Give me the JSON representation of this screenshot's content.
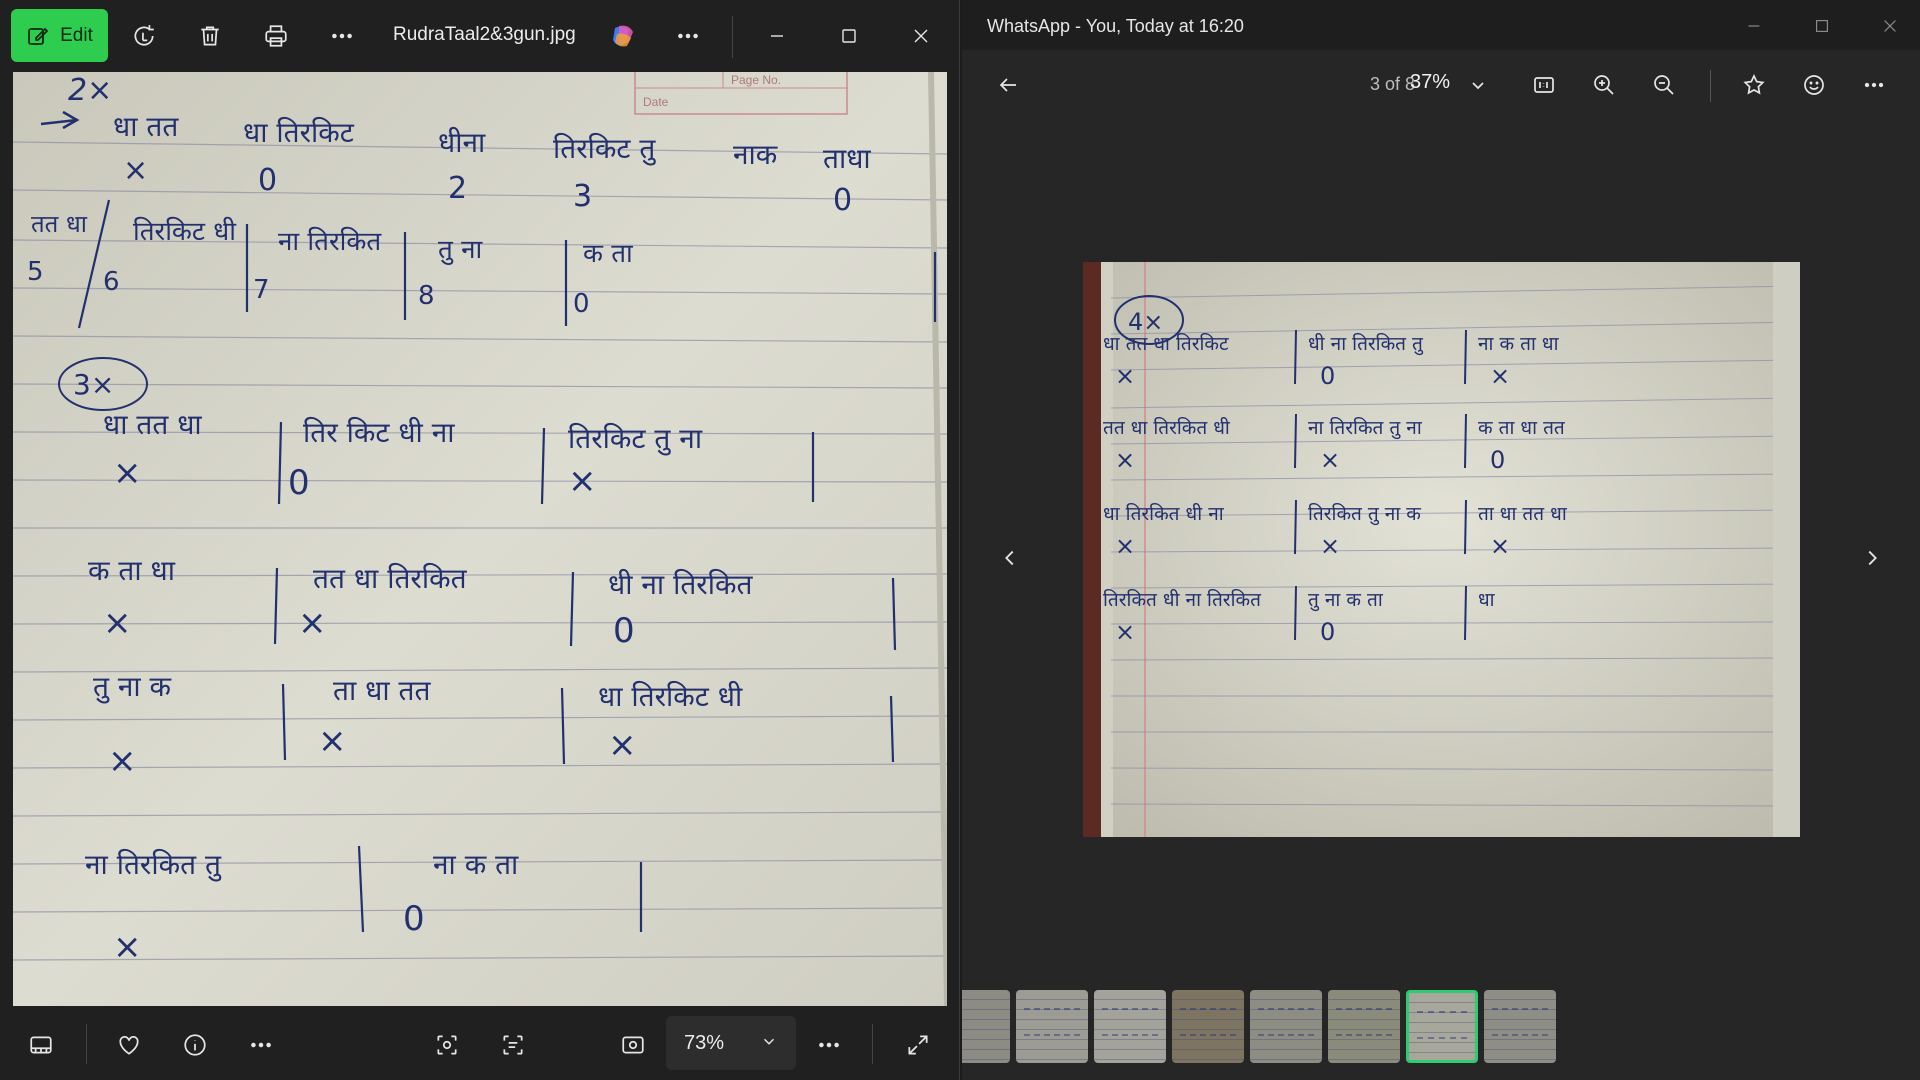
{
  "photos": {
    "edit_label": "Edit",
    "filename": "RudraTaal2&3gun.jpg",
    "zoom": "73%",
    "notebook": {
      "header_label": "Page No.",
      "date_label": "Date",
      "mark_top": "2×",
      "mark_3x": "3×",
      "row1_bols": [
        "धा तत",
        "धा तिरकिट",
        "धीना",
        "तिरकिट तु",
        "नाक",
        "ताधा"
      ],
      "row1_beats": [
        "×",
        "0",
        "2",
        "3",
        "",
        "0"
      ],
      "row2_bols": [
        "तत धा",
        "तिरकिट धी",
        "ना तिरकित",
        "तु ना",
        "क ता"
      ],
      "row2_beats": [
        "5",
        "6",
        "7",
        "8",
        "0"
      ],
      "s3_row1": [
        "धा तत धा",
        "तिर किट धी ना",
        "तिरकिट तु ना"
      ],
      "s3_row1_marks": [
        "×",
        "0",
        "×"
      ],
      "s3_row2": [
        "क ता धा",
        "तत धा तिरकित",
        "धी ना तिरकित"
      ],
      "s3_row2_marks": [
        "×",
        "×",
        "0"
      ],
      "s3_row3": [
        "तु ना क",
        "ता धा तत",
        "धा तिरकिट धी"
      ],
      "s3_row3_marks": [
        "×",
        "×",
        "×"
      ],
      "s3_row4": [
        "ना तिरकित तु",
        "ना क ता"
      ],
      "s3_row4_marks": [
        "×",
        "0"
      ]
    }
  },
  "whatsapp": {
    "title": "WhatsApp - You, Today at 16:20",
    "counter_prefix": "3 of 8",
    "zoom": "37%",
    "notebook": {
      "mark": "4×",
      "rows": [
        [
          "धा तत धा तिरकिट",
          "धी ना तिरकित तु",
          "ना क ता धा"
        ],
        [
          "तत धा तिरकित धी",
          "ना तिरकित तु ना",
          "क ता धा तत"
        ],
        [
          "धा तिरकित धी ना",
          "तिरकित तु ना क",
          "ता धा तत धा"
        ],
        [
          "तिरकित धी ना तिरकित",
          "तु ना क ता",
          "धा"
        ]
      ],
      "marks": [
        [
          "×",
          "0",
          "×"
        ],
        [
          "×",
          "×",
          "0"
        ],
        [
          "×",
          "×",
          "×"
        ],
        [
          "×",
          "0",
          ""
        ]
      ]
    }
  }
}
